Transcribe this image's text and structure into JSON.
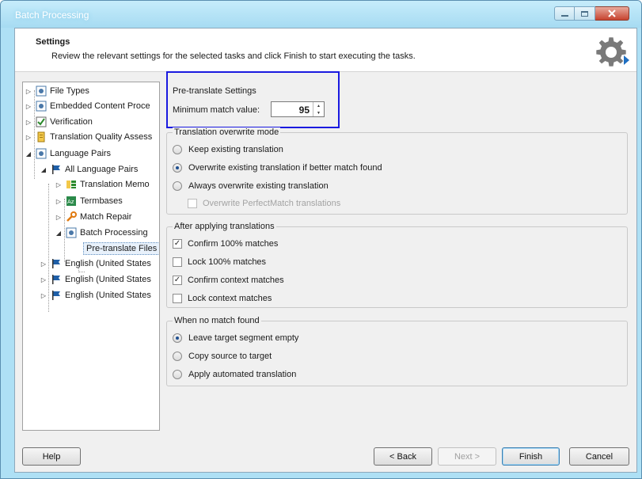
{
  "window": {
    "title": "Batch Processing"
  },
  "header": {
    "title": "Settings",
    "subtitle": "Review the relevant settings for the selected tasks and click Finish to start executing the tasks."
  },
  "tree": {
    "items": [
      {
        "label": "File Types",
        "icon": "file-types-icon"
      },
      {
        "label": "Embedded Content Proce",
        "icon": "embedded-content-icon"
      },
      {
        "label": "Verification",
        "icon": "verification-icon"
      },
      {
        "label": "Translation Quality Assess",
        "icon": "quality-assessment-icon"
      },
      {
        "label": "Language Pairs",
        "icon": "language-pairs-icon"
      },
      {
        "label": "All Language Pairs",
        "icon": "flag-icon"
      },
      {
        "label": "Translation Memo",
        "icon": "translation-memory-icon"
      },
      {
        "label": "Termbases",
        "icon": "termbase-icon"
      },
      {
        "label": "Match Repair",
        "icon": "wrench-icon"
      },
      {
        "label": "Batch Processing",
        "icon": "batch-processing-icon"
      },
      {
        "label": "Pre-translate Files",
        "icon": ""
      },
      {
        "label": "English (United States",
        "icon": "flag-icon"
      },
      {
        "label": "English (United States",
        "icon": "flag-icon"
      },
      {
        "label": "English (United States",
        "icon": "flag-icon"
      }
    ]
  },
  "pretranslate": {
    "title": "Pre-translate Settings",
    "min_match_label": "Minimum match value:",
    "min_match_value": "95"
  },
  "overwrite": {
    "title": "Translation overwrite mode",
    "options": [
      {
        "label": "Keep existing translation",
        "selected": false
      },
      {
        "label": "Overwrite existing translation if better match found",
        "selected": true
      },
      {
        "label": "Always overwrite existing translation",
        "selected": false
      }
    ],
    "sub_option": {
      "label": "Overwrite PerfectMatch translations",
      "checked": false,
      "enabled": false
    }
  },
  "after_applying": {
    "title": "After applying translations",
    "options": [
      {
        "label": "Confirm 100% matches",
        "checked": true
      },
      {
        "label": "Lock 100% matches",
        "checked": false
      },
      {
        "label": "Confirm context matches",
        "checked": true
      },
      {
        "label": "Lock context matches",
        "checked": false
      }
    ]
  },
  "no_match": {
    "title": "When no match found",
    "options": [
      {
        "label": "Leave target segment empty",
        "selected": true
      },
      {
        "label": "Copy source to target",
        "selected": false
      },
      {
        "label": "Apply automated translation",
        "selected": false
      }
    ]
  },
  "buttons": {
    "help": "Help",
    "back": "< Back",
    "next": "Next >",
    "finish": "Finish",
    "cancel": "Cancel"
  },
  "colors": {
    "highlight": "#1a1ae0",
    "selection": "#e8f1fb"
  }
}
